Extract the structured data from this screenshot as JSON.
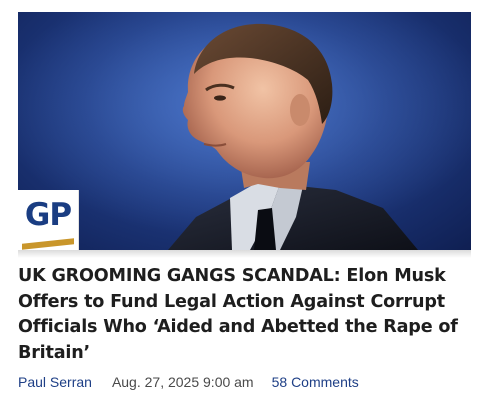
{
  "article": {
    "headline": "UK GROOMING GANGS SCANDAL: Elon Musk Offers to Fund Legal Action Against Corrupt Officials Who ‘Aided and Abetted the Rape of Britain’",
    "author": "Paul Serran",
    "date": "Aug. 27, 2025 9:00 am",
    "comments": "58 Comments"
  },
  "logo": {
    "text": "GP",
    "text_color": "#1a3d82",
    "stripe_color": "#c9962b"
  },
  "image": {
    "subject": "portrait-photo",
    "background_color": "#203c84"
  },
  "colors": {
    "link": "#1e3f86",
    "headline": "#1e1e1e",
    "meta_text": "#4a4a4a"
  }
}
